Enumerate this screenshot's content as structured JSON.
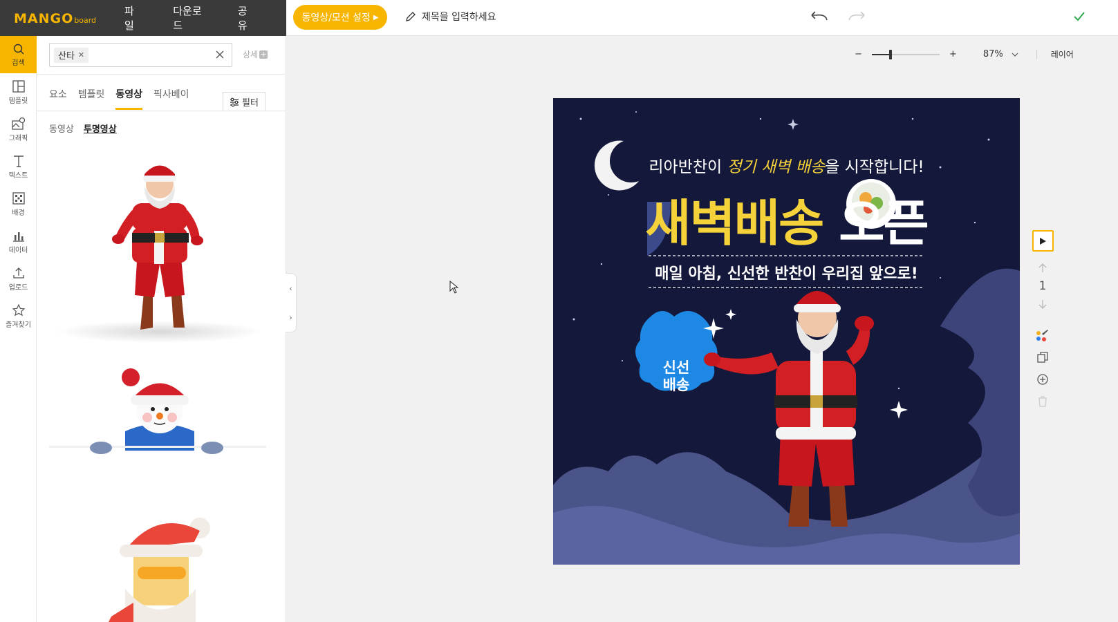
{
  "app": {
    "logo_main": "MANGO",
    "logo_sub": "board",
    "menu": [
      "파일",
      "다운로드",
      "공유"
    ],
    "video_button": "동영상/모션 설정",
    "title_placeholder": "제목을 입력하세요"
  },
  "rail": [
    {
      "label": "검색",
      "icon": "search-icon"
    },
    {
      "label": "템플릿",
      "icon": "template-icon"
    },
    {
      "label": "그래픽",
      "icon": "graphic-icon"
    },
    {
      "label": "텍스트",
      "icon": "text-icon"
    },
    {
      "label": "배경",
      "icon": "background-icon"
    },
    {
      "label": "데이터",
      "icon": "chart-icon"
    },
    {
      "label": "업로드",
      "icon": "upload-icon"
    },
    {
      "label": "즐겨찾기",
      "icon": "star-icon"
    }
  ],
  "panel": {
    "search_chip": "산타",
    "detail_label": "상세",
    "tabs": [
      "요소",
      "템플릿",
      "동영상",
      "픽사베이"
    ],
    "active_tab": "동영상",
    "filter_label": "필터",
    "subtabs": [
      "동영상",
      "투명영상"
    ],
    "active_subtab": "투명영상",
    "results": [
      {
        "name": "santa-dancing-3d"
      },
      {
        "name": "snowman-peeking"
      },
      {
        "name": "santa-cartoon"
      }
    ]
  },
  "toolbar": {
    "zoom_minus": "−",
    "zoom_plus": "+",
    "zoom_level": 0.28,
    "zoom_value": "87%",
    "layer_label": "레이어"
  },
  "canvas": {
    "line1_pre": "리아반찬이 ",
    "line1_highlight": "정기 새벽 배송",
    "line1_post": "을 시작합니다!",
    "headline_yellow": "새벽배송 ",
    "headline_white": "오픈",
    "subline": "매일 아침, 신선한 반찬이 우리집 앞으로!",
    "badge": [
      "신선",
      "배송"
    ],
    "colors": {
      "background": "#14183a",
      "headline": "#f5d23a",
      "badge": "#1e88e5"
    }
  },
  "side_tools": {
    "page_number": "1"
  }
}
